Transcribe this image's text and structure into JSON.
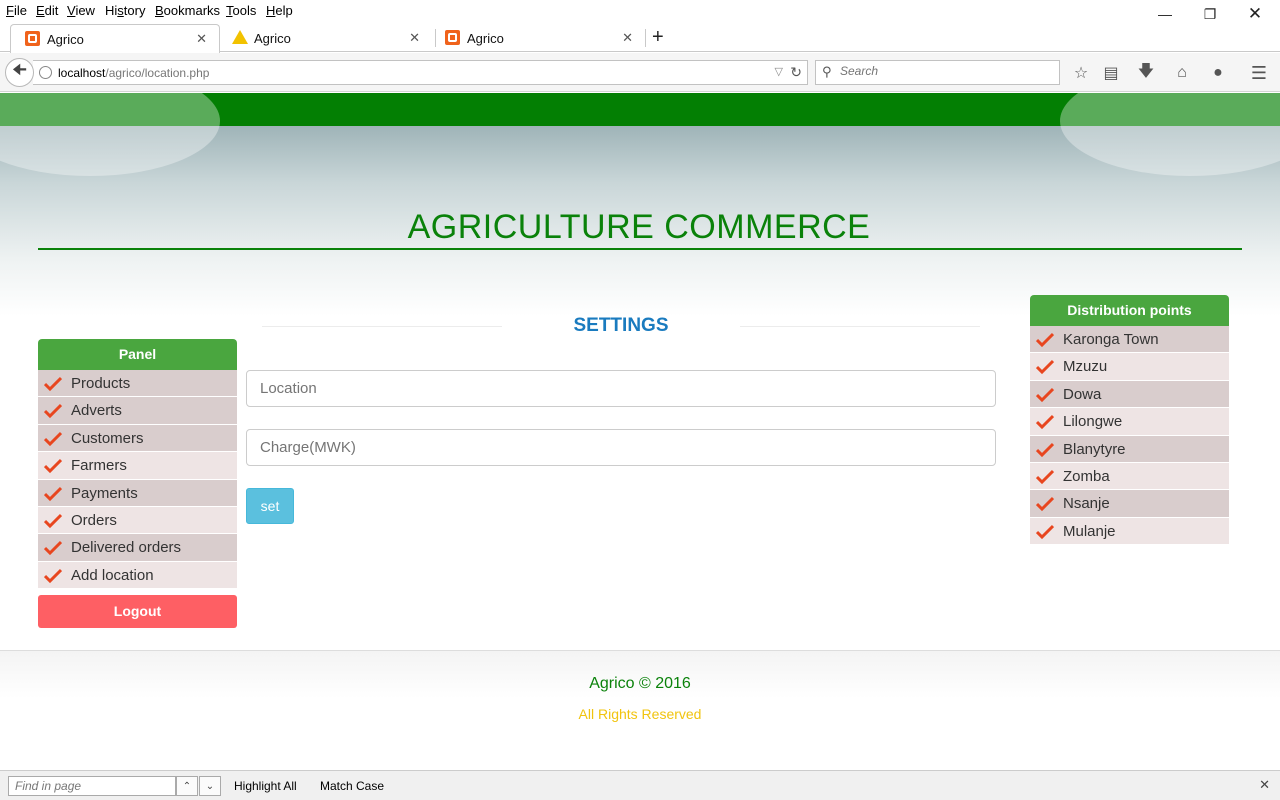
{
  "menubar": {
    "items": [
      "File",
      "Edit",
      "View",
      "History",
      "Bookmarks",
      "Tools",
      "Help"
    ],
    "underline": [
      "F",
      "E",
      "V",
      "s",
      "B",
      "T",
      "H"
    ]
  },
  "tabs": [
    {
      "title": "Agrico",
      "icon": "xampp-icon",
      "active": true
    },
    {
      "title": "Agrico",
      "icon": "warning-icon",
      "active": false
    },
    {
      "title": "Agrico",
      "icon": "xampp-icon",
      "active": false
    }
  ],
  "navbar": {
    "url_host": "localhost",
    "url_path": "/agrico/location.php",
    "search_placeholder": "Search"
  },
  "site": {
    "title": "AGRICULTURE COMMERCE",
    "accent": "#037f03"
  },
  "panel": {
    "header": "Panel",
    "items": [
      "Products",
      "Adverts",
      "Customers",
      "Farmers",
      "Payments",
      "Orders",
      "Delivered orders",
      "Add location"
    ],
    "logout": "Logout"
  },
  "settings": {
    "title": "SETTINGS",
    "location_placeholder": "Location",
    "charge_placeholder": "Charge(MWK)",
    "set_label": "set"
  },
  "distribution": {
    "header": "Distribution points",
    "items": [
      "Karonga Town",
      "Mzuzu",
      "Dowa",
      "Lilongwe",
      "Blanytyre",
      "Zomba",
      "Nsanje",
      "Mulanje"
    ]
  },
  "footer": {
    "copyright": "Agrico © 2016",
    "rights": "All Rights Reserved"
  },
  "findbar": {
    "placeholder": "Find in page",
    "highlight_all": "Highlight All",
    "match_case": "Match Case"
  }
}
